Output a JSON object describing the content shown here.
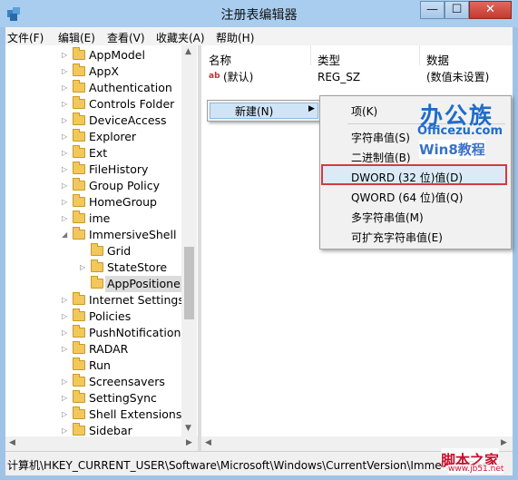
{
  "window": {
    "title": "注册表编辑器",
    "min": "—",
    "max": "☐",
    "close": "✕"
  },
  "menubar": [
    "文件(F)",
    "编辑(E)",
    "查看(V)",
    "收藏夹(A)",
    "帮助(H)"
  ],
  "tree": [
    {
      "label": "AppModel",
      "expander": "▷"
    },
    {
      "label": "AppX",
      "expander": "▷"
    },
    {
      "label": "Authentication",
      "expander": "▷"
    },
    {
      "label": "Controls Folder",
      "expander": "▷"
    },
    {
      "label": "DeviceAccess",
      "expander": "▷"
    },
    {
      "label": "Explorer",
      "expander": "▷"
    },
    {
      "label": "Ext",
      "expander": "▷"
    },
    {
      "label": "FileHistory",
      "expander": "▷"
    },
    {
      "label": "Group Policy",
      "expander": "▷"
    },
    {
      "label": "HomeGroup",
      "expander": "▷"
    },
    {
      "label": "ime",
      "expander": "▷"
    },
    {
      "label": "ImmersiveShell",
      "expander": "◢"
    },
    {
      "label": "Grid",
      "expander": ""
    },
    {
      "label": "StateStore",
      "expander": "▷"
    },
    {
      "label": "AppPositione",
      "expander": "",
      "selected": true
    },
    {
      "label": "Internet Settings",
      "expander": "▷"
    },
    {
      "label": "Policies",
      "expander": "▷"
    },
    {
      "label": "PushNotifications",
      "expander": "▷"
    },
    {
      "label": "RADAR",
      "expander": "▷"
    },
    {
      "label": "Run",
      "expander": ""
    },
    {
      "label": "Screensavers",
      "expander": "▷"
    },
    {
      "label": "SettingSync",
      "expander": "▷"
    },
    {
      "label": "Shell Extensions",
      "expander": "▷"
    },
    {
      "label": "Sidebar",
      "expander": "▷"
    }
  ],
  "list": {
    "columns": [
      "名称",
      "类型",
      "数据"
    ],
    "rows": [
      {
        "name": "(默认)",
        "type": "REG_SZ",
        "data": "(数值未设置)",
        "icon": "ab-string-icon"
      }
    ]
  },
  "context_menu": {
    "new_label": "新建(N)",
    "submenu_arrow": "▶",
    "items": [
      "项(K)",
      "字符串值(S)",
      "二进制值(B)",
      "DWORD (32 位)值(D)",
      "QWORD (64 位)值(Q)",
      "多字符串值(M)",
      "可扩充字符串值(E)"
    ],
    "highlighted_index": 3
  },
  "status": "计算机\\HKEY_CURRENT_USER\\Software\\Microsoft\\Windows\\CurrentVersion\\ImmersiveShell\\",
  "watermarks": {
    "brand": "办公族",
    "site": "Officezu.com",
    "tag": "Win8教程",
    "bottom": "脚本之家",
    "bottom_url": "www.jb51.net"
  },
  "colors": {
    "title_bar": "#a9cdef",
    "highlight_border": "#d23c3c",
    "watermark_blue": "#1e6cc8"
  }
}
